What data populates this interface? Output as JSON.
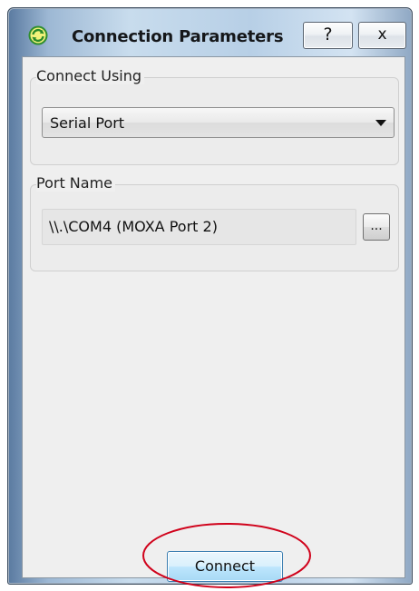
{
  "window": {
    "title": "Connection Parameters",
    "help_label": "?",
    "close_label": "x",
    "app_icon": "refresh-icon"
  },
  "connect_using": {
    "label": "Connect Using",
    "selected": "Serial Port"
  },
  "port_name": {
    "label": "Port Name",
    "value": "\\\\.\\COM4 (MOXA Port 2)",
    "browse_label": "..."
  },
  "actions": {
    "connect_label": "Connect"
  },
  "colors": {
    "annotation": "#d0021b",
    "icon_green": "#3aa33a"
  }
}
